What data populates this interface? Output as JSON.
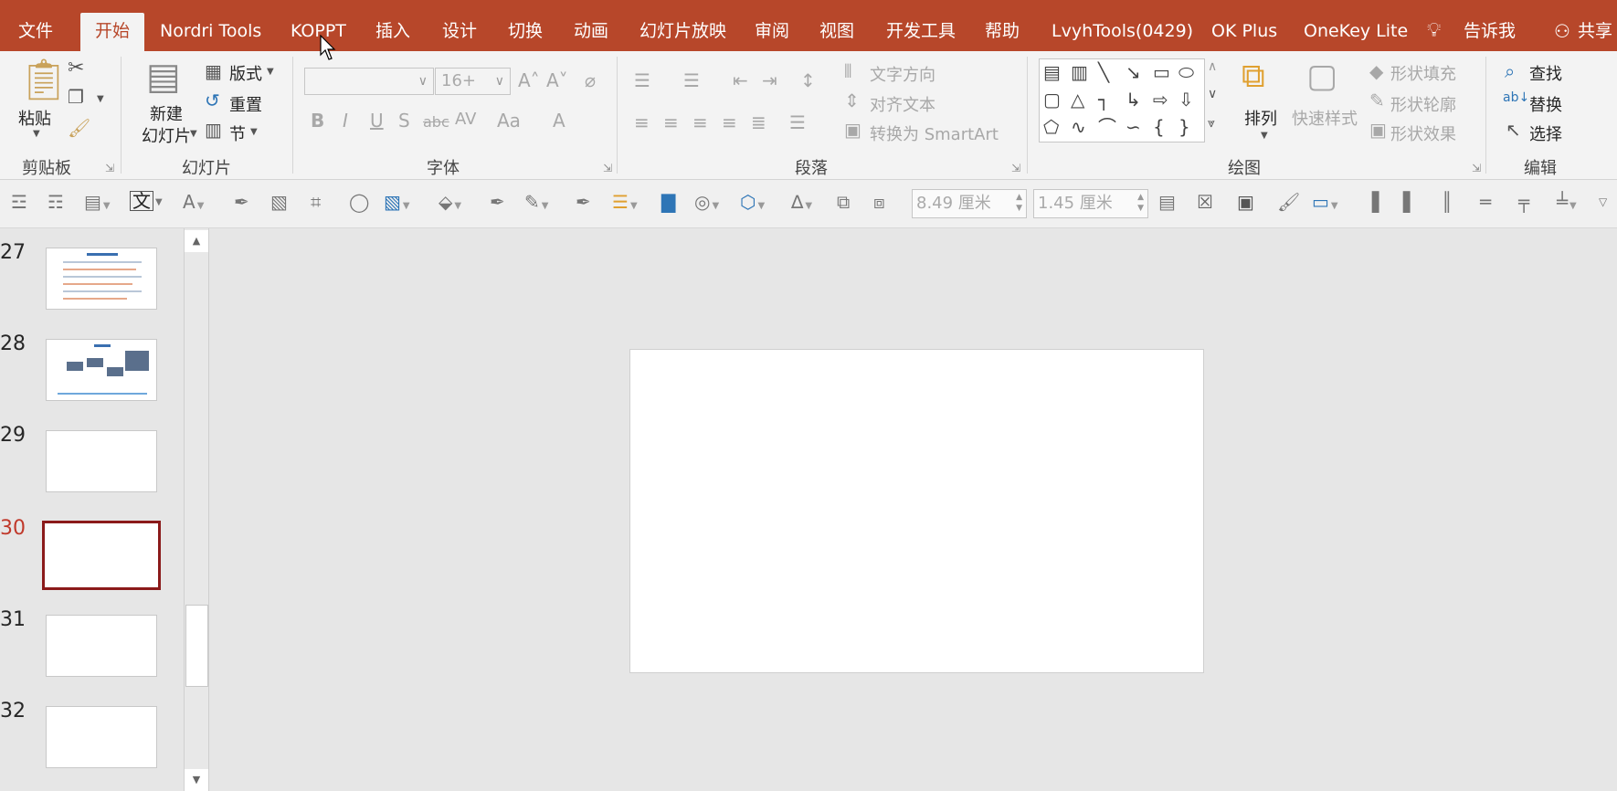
{
  "tabs": [
    {
      "label": "文件"
    },
    {
      "label": "开始",
      "active": true
    },
    {
      "label": "Nordri Tools"
    },
    {
      "label": "KOPPT"
    },
    {
      "label": "插入"
    },
    {
      "label": "设计"
    },
    {
      "label": "切换"
    },
    {
      "label": "动画"
    },
    {
      "label": "幻灯片放映"
    },
    {
      "label": "审阅"
    },
    {
      "label": "视图"
    },
    {
      "label": "开发工具"
    },
    {
      "label": "帮助"
    },
    {
      "label": "LvyhTools(0429)"
    },
    {
      "label": "OK Plus"
    },
    {
      "label": "OneKey Lite"
    },
    {
      "label": "告诉我"
    },
    {
      "label": "共享"
    }
  ],
  "ribbon": {
    "clipboard": {
      "group": "剪贴板",
      "paste": "粘贴"
    },
    "slides": {
      "group": "幻灯片",
      "new_slide_1": "新建",
      "new_slide_2": "幻灯片",
      "layout": "版式",
      "reset": "重置",
      "section": "节"
    },
    "font": {
      "group": "字体",
      "font_size": "16+",
      "bold": "B",
      "italic": "I",
      "underline": "U",
      "shadow": "S",
      "strike": "abc",
      "spacing": "AV",
      "case": "Aa",
      "color": "A"
    },
    "paragraph": {
      "group": "段落",
      "text_direction": "文字方向",
      "align_text": "对齐文本",
      "smartart": "转换为 SmartArt"
    },
    "drawing": {
      "group": "绘图",
      "arrange": "排列",
      "quick_styles": "快速样式",
      "shape_fill": "形状填充",
      "shape_outline": "形状轮廓",
      "shape_effects": "形状效果"
    },
    "editing": {
      "group": "编辑",
      "find": "查找",
      "replace": "替换",
      "select": "选择"
    }
  },
  "toolbar2": {
    "width_value": "8.49 厘米",
    "height_value": "1.45 厘米",
    "text_icon": "文"
  },
  "slides": [
    {
      "number": "27",
      "content": "text-heavy"
    },
    {
      "number": "28",
      "content": "diagram"
    },
    {
      "number": "29",
      "content": "blank"
    },
    {
      "number": "30",
      "content": "blank",
      "selected": true
    },
    {
      "number": "31",
      "content": "blank"
    },
    {
      "number": "32",
      "content": "blank"
    }
  ],
  "colors": {
    "accent": "#b7472a",
    "selected_border": "#8b1a1a",
    "active_number": "#c0392b"
  }
}
